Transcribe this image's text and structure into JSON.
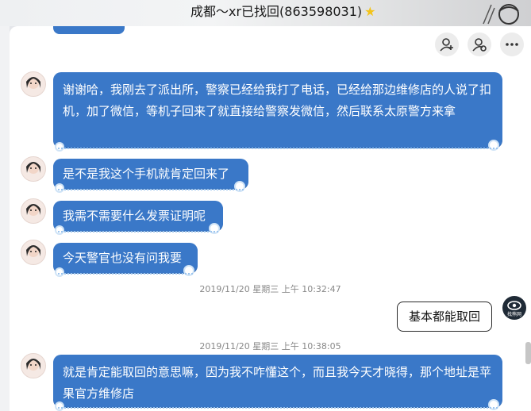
{
  "window": {
    "title": "成都～xr已找回(863598031)",
    "star_icon": "star-icon"
  },
  "toolbar": {
    "icons": [
      "add-contact-icon",
      "contact-settings-icon",
      "more-icon"
    ]
  },
  "messages": [
    {
      "sender": "contact",
      "text": "谢谢哈，我刚去了派出所，警察已经给我打了电话，已经给那边维修店的人说了扣机，加了微信，等机子回来了就直接给警察发微信，然后联系太原警方来拿"
    },
    {
      "sender": "contact",
      "text": "是不是我这个手机就肯定回来了"
    },
    {
      "sender": "contact",
      "text": "我需不需要什么发票证明呢"
    },
    {
      "sender": "contact",
      "text": "今天警官也没有问我要"
    },
    {
      "sender": "self",
      "text": "基本都能取回"
    },
    {
      "sender": "contact",
      "text": "就是肯定能取回的意思嘛，因为我不咋懂这个，而且我今天才晓得，那个地址是苹果官方维修店"
    }
  ],
  "timestamps": [
    "2019/11/20 星期三 上午 10:32:47",
    "2019/11/20 星期三 上午 10:38:05"
  ],
  "self_avatar_label": "找熊网",
  "colors": {
    "bubble": "#3a78c8",
    "bubble_text": "#ffffff",
    "timestamp": "#888888"
  }
}
